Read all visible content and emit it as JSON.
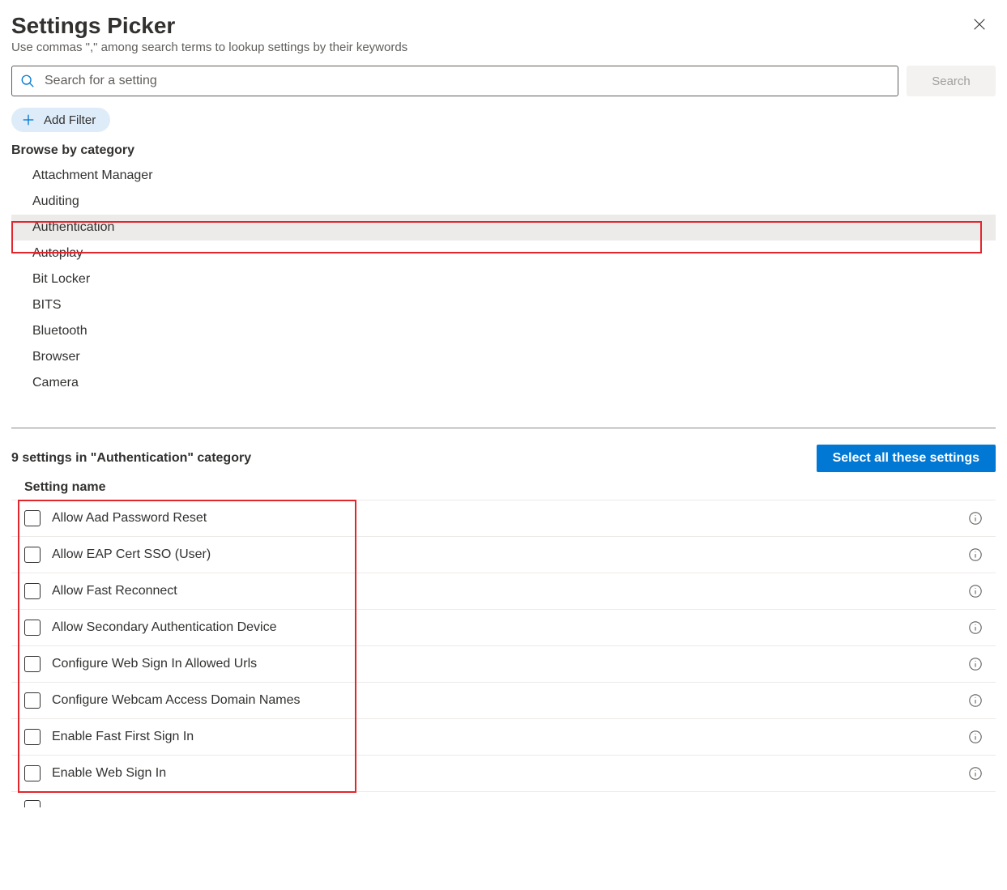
{
  "header": {
    "title": "Settings Picker",
    "subtitle": "Use commas \",\" among search terms to lookup settings by their keywords"
  },
  "search": {
    "placeholder": "Search for a setting",
    "button_label": "Search"
  },
  "filter": {
    "add_filter_label": "Add Filter"
  },
  "browse": {
    "label": "Browse by category",
    "selected_index": 2,
    "categories": [
      "Attachment Manager",
      "Auditing",
      "Authentication",
      "Autoplay",
      "Bit Locker",
      "BITS",
      "Bluetooth",
      "Browser",
      "Camera"
    ]
  },
  "results": {
    "count_text": "9 settings in \"Authentication\" category",
    "select_all_label": "Select all these settings",
    "column_header": "Setting name",
    "settings": [
      "Allow Aad Password Reset",
      "Allow EAP Cert SSO (User)",
      "Allow Fast Reconnect",
      "Allow Secondary Authentication Device",
      "Configure Web Sign In Allowed Urls",
      "Configure Webcam Access Domain Names",
      "Enable Fast First Sign In",
      "Enable Web Sign In"
    ]
  },
  "colors": {
    "primary": "#0078d4",
    "highlight_border": "#e3262d"
  }
}
